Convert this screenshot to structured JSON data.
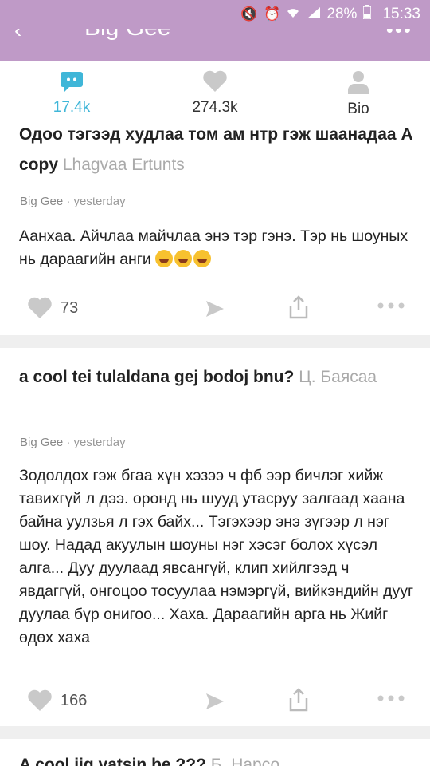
{
  "status_bar": {
    "battery": "28%",
    "time": "15:33"
  },
  "app_bar": {
    "title": "Big Gee"
  },
  "stats": [
    {
      "label": "17.4k",
      "icon": "chat-icon"
    },
    {
      "label": "274.3k",
      "icon": "heart-icon"
    },
    {
      "label": "Bio",
      "icon": "person-icon"
    }
  ],
  "posts": [
    {
      "question": "Одоо тэгээд худлаа том ам нтр гэж шаанадаа А copy",
      "asker": "Lhagvaa Ertunts",
      "author": "Big Gee",
      "time": "· yesterday",
      "answer": "Аанхаа. Айчлаа майчлаа энэ тэр гэнэ. Тэр нь шоуных нь дараагийн анги",
      "likes": "73"
    },
    {
      "question": "a cool tei tulaldana gej bodoj bnu?",
      "asker": "Ц. Баясаа",
      "author": "Big Gee",
      "time": "· yesterday",
      "answer": "Зодолдох гэж бгаа хүн хэзээ ч фб ээр бичлэг хийж тавихгүй л дээ. оронд нь шууд утасруу залгаад хаана байна уулзья л гэх байх... Тэгэхээр энэ зүгээр л нэг шоу. Надад акуулын шоуны нэг хэсэг болох хүсэл алга... Дуу дуулаад явсангүй, клип хийлгээд ч явдаггүй, онгоцоо тосуулаа нэмэргүй, вийкэндийн дууг дуулаа бүр онигоо... Хаха. Дараагийн арга нь Жийг өдөх хаха",
      "likes": "166"
    },
    {
      "question": "A cool iig yatsin be ???",
      "asker": "Б. Нарсо"
    }
  ]
}
